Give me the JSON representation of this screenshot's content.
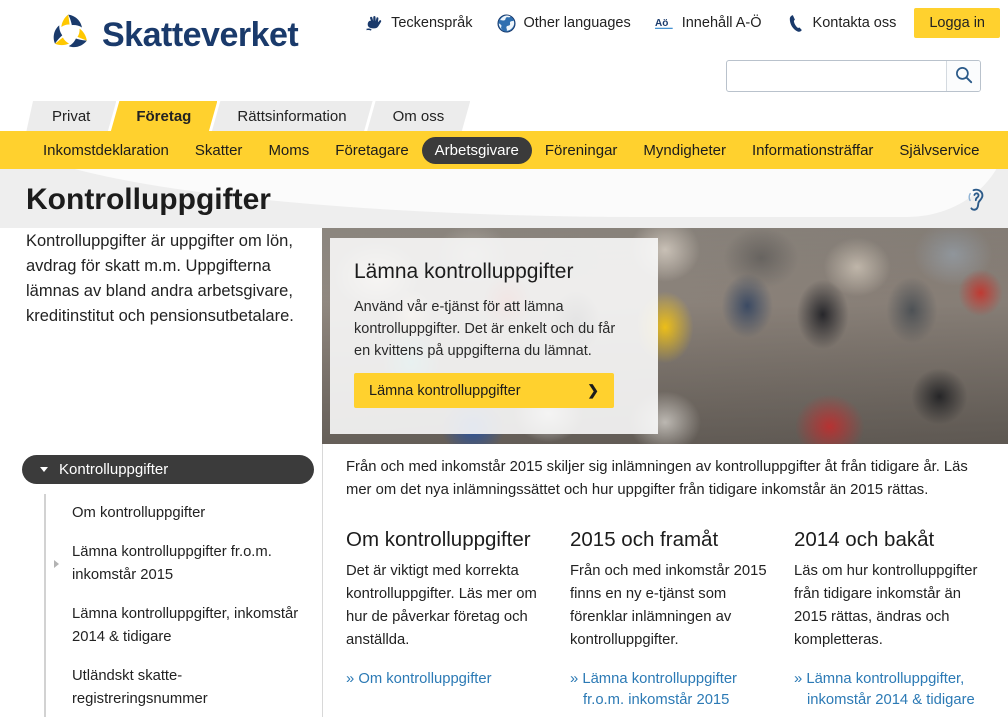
{
  "brand": {
    "name": "Skatteverket",
    "logo_icon": "skatteverket-pinwheel-logo",
    "navy": "#1a3a6b",
    "yellow": "#ffd12e",
    "link_blue": "#2c7ab5",
    "dark_pill": "#3b3b3b"
  },
  "utility": {
    "items": [
      {
        "label": "Teckenspråk",
        "icon": "sign-language-icon"
      },
      {
        "label": "Other languages",
        "icon": "globe-icon"
      },
      {
        "label": "Innehåll A-Ö",
        "icon": "a-to-o-icon"
      },
      {
        "label": "Kontakta oss",
        "icon": "phone-icon"
      }
    ],
    "login_label": "Logga in"
  },
  "search": {
    "value": "",
    "placeholder": "",
    "icon": "search-icon"
  },
  "tabs": [
    {
      "label": "Privat",
      "active": false
    },
    {
      "label": "Företag",
      "active": true
    },
    {
      "label": "Rättsinformation",
      "active": false
    },
    {
      "label": "Om oss",
      "active": false
    }
  ],
  "subnav": [
    {
      "label": "Inkomstdeklaration",
      "active": false
    },
    {
      "label": "Skatter",
      "active": false
    },
    {
      "label": "Moms",
      "active": false
    },
    {
      "label": "Företagare",
      "active": false
    },
    {
      "label": "Arbetsgivare",
      "active": true
    },
    {
      "label": "Föreningar",
      "active": false
    },
    {
      "label": "Myndigheter",
      "active": false
    },
    {
      "label": "Informationsträffar",
      "active": false
    },
    {
      "label": "Självservice",
      "active": false
    }
  ],
  "page": {
    "title": "Kontrolluppgifter",
    "listen_icon": "listen-ear-icon",
    "intro": "Kontrolluppgifter är uppgifter om lön, avdrag för skatt m.m. Uppgifterna lämnas av bland andra arbetsgivare, kreditinstitut och pensionsutbetalare."
  },
  "hero": {
    "heading": "Lämna kontrolluppgifter",
    "body": "Använd vår e-tjänst för att lämna kontrolluppgifter. Det är enkelt och du får en kvittens på uppgifterna du lämnat.",
    "cta_label": "Lämna kontrolluppgifter",
    "cta_icon": "chevron-right-icon",
    "image_alt": "crowd-of-people-photo"
  },
  "sidebar": {
    "header": "Kontrolluppgifter",
    "header_icon": "chevron-down-icon",
    "items": [
      {
        "label": "Om kontrolluppgifter",
        "has_arrow": false
      },
      {
        "label": "Lämna kontrolluppgifter fr.o.m. inkomstår 2015",
        "has_arrow": true
      },
      {
        "label": "Lämna kontrolluppgifter, inkomstår 2014 & tidigare",
        "has_arrow": false
      },
      {
        "label": "Utländskt skatte-registreringsnummer",
        "has_arrow": false
      }
    ]
  },
  "main": {
    "intro": "Från och med inkomstår 2015 skiljer sig inlämningen av kontrolluppgifter åt från tidigare år. Läs mer om det nya inlämningssättet och hur uppgifter från tidigare inkomstår än 2015 rättas.",
    "columns": [
      {
        "heading": "Om kontrolluppgifter",
        "body": "Det är viktigt med korrekta kontrolluppgifter. Läs mer om hur de påverkar företag och anställda.",
        "link": "» Om kontrolluppgifter"
      },
      {
        "heading": "2015 och framåt",
        "body": "Från och med inkomstår 2015 finns en ny e-tjänst som förenklar inlämningen av kontrolluppgifter.",
        "link": "» Lämna kontrolluppgifter fr.o.m. inkomstår 2015"
      },
      {
        "heading": "2014 och bakåt",
        "body": "Läs om hur kontrolluppgifter från tidigare inkomstår än 2015 rättas, ändras och kompletteras.",
        "link": "» Lämna kontrolluppgifter, inkomstår 2014 & tidigare"
      }
    ]
  }
}
